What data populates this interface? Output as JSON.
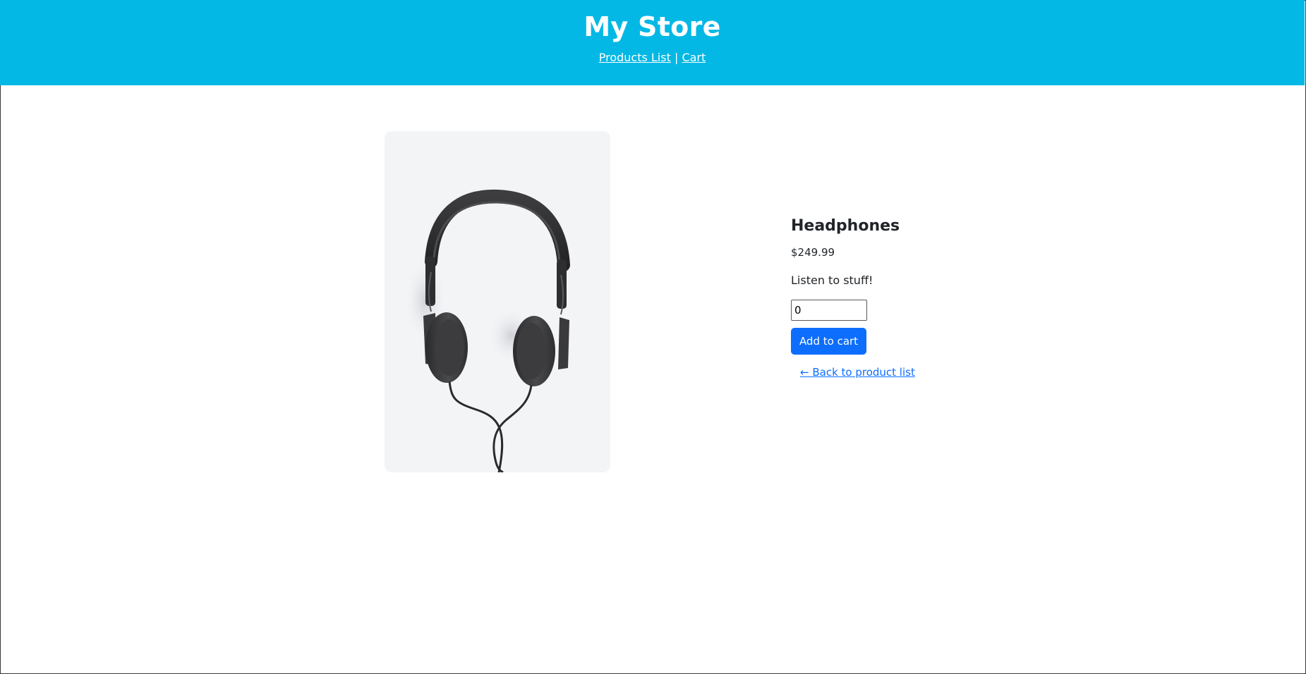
{
  "header": {
    "title": "My Store",
    "nav": {
      "products_label": "Products List",
      "separator": "|",
      "cart_label": "Cart"
    },
    "background_color": "#03b8e5"
  },
  "product": {
    "image_icon": "headphones-photo",
    "name": "Headphones",
    "price": "$249.99",
    "description": "Listen to stuff!",
    "quantity_value": "0",
    "add_button_label": "Add to cart",
    "back_link_label": "← Back to product list"
  },
  "colors": {
    "accent": "#0d6efd",
    "image_background": "#f3f4f6"
  }
}
